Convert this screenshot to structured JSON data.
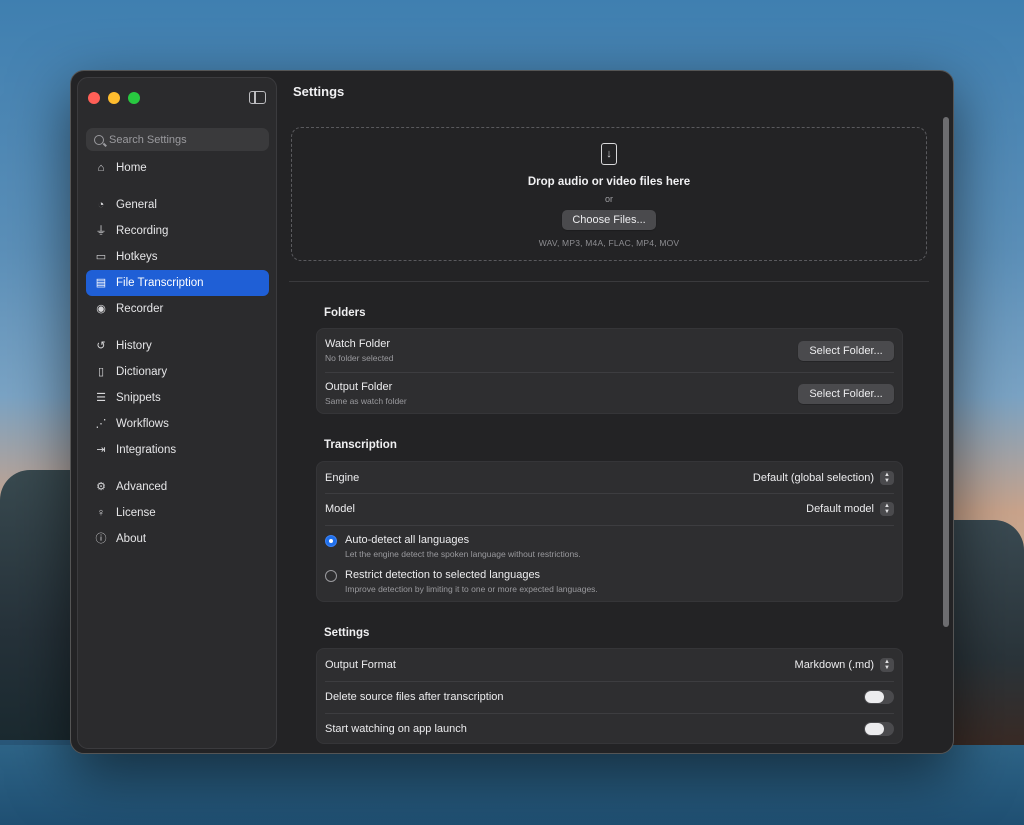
{
  "window": {
    "title": "Settings"
  },
  "sidebar": {
    "search_placeholder": "Search Settings",
    "items": [
      {
        "label": "Home",
        "icon": "home-icon"
      },
      {
        "label": "General",
        "icon": "general-icon"
      },
      {
        "label": "Recording",
        "icon": "microphone-icon"
      },
      {
        "label": "Hotkeys",
        "icon": "keyboard-icon"
      },
      {
        "label": "File Transcription",
        "icon": "document-icon",
        "active": true
      },
      {
        "label": "Recorder",
        "icon": "recorder-icon"
      },
      {
        "label": "History",
        "icon": "history-icon"
      },
      {
        "label": "Dictionary",
        "icon": "book-icon"
      },
      {
        "label": "Snippets",
        "icon": "snippets-icon"
      },
      {
        "label": "Workflows",
        "icon": "workflows-icon"
      },
      {
        "label": "Integrations",
        "icon": "integrations-icon"
      },
      {
        "label": "Advanced",
        "icon": "gears-icon"
      },
      {
        "label": "License",
        "icon": "key-icon"
      },
      {
        "label": "About",
        "icon": "info-icon"
      }
    ]
  },
  "dropzone": {
    "title": "Drop audio or video files here",
    "or": "or",
    "button": "Choose Files...",
    "formats": "WAV, MP3, M4A, FLAC, MP4, MOV"
  },
  "folders": {
    "title": "Folders",
    "watch": {
      "title": "Watch Folder",
      "subtitle": "No folder selected",
      "button": "Select Folder..."
    },
    "output": {
      "title": "Output Folder",
      "subtitle": "Same as watch folder",
      "button": "Select Folder..."
    }
  },
  "transcription": {
    "title": "Transcription",
    "engine": {
      "label": "Engine",
      "value": "Default (global selection)"
    },
    "model": {
      "label": "Model",
      "value": "Default model"
    },
    "auto_detect": {
      "title": "Auto-detect all languages",
      "subtitle": "Let the engine detect the spoken language without restrictions.",
      "selected": true
    },
    "restrict": {
      "title": "Restrict detection to selected languages",
      "subtitle": "Improve detection by limiting it to one or more expected languages.",
      "selected": false
    }
  },
  "settings": {
    "title": "Settings",
    "output_format": {
      "label": "Output Format",
      "value": "Markdown (.md)"
    },
    "delete_source": {
      "label": "Delete source files after transcription",
      "on": false
    },
    "start_watching": {
      "label": "Start watching on app launch",
      "on": false
    }
  }
}
